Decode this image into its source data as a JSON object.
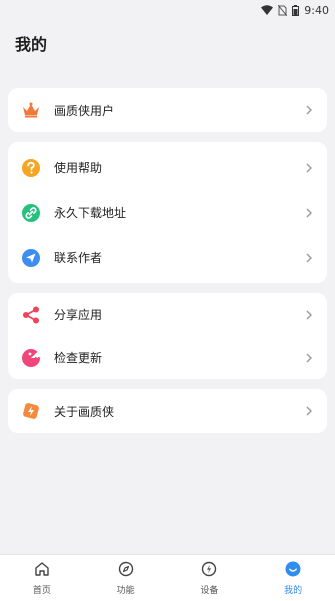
{
  "status_bar": {
    "time": "9:40"
  },
  "page": {
    "title": "我的"
  },
  "sections": {
    "account": {
      "vip_label": "画质侠用户"
    },
    "support": {
      "help_label": "使用帮助",
      "download_label": "永久下载地址",
      "contact_label": "联系作者"
    },
    "app": {
      "share_label": "分享应用",
      "update_label": "检查更新"
    },
    "about": {
      "about_label": "关于画质侠"
    }
  },
  "bottom_nav": {
    "home": "首页",
    "features": "功能",
    "settings": "设备",
    "mine": "我的"
  },
  "colors": {
    "accent": "#2f8cf0",
    "crown": "#f07a3a",
    "help": "#f5a623",
    "download": "#27c07c",
    "contact": "#3d8ef0",
    "share": "#f0445a",
    "update": "#f0467a",
    "about": "#f38b3c"
  }
}
